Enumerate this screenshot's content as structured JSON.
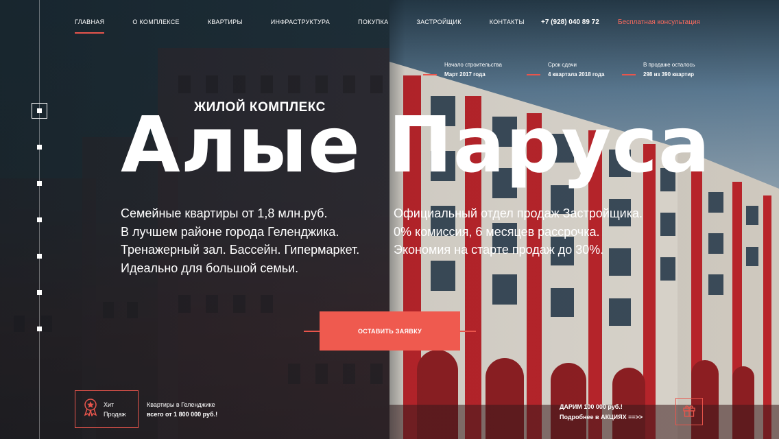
{
  "nav": {
    "items": [
      {
        "label": "ГЛАВНАЯ",
        "active": true
      },
      {
        "label": "О КОМПЛЕКСЕ",
        "active": false
      },
      {
        "label": "КВАРТИРЫ",
        "active": false
      },
      {
        "label": "ИНФРАСТРУКТУРА",
        "active": false
      },
      {
        "label": "ПОКУПКА",
        "active": false
      },
      {
        "label": "ЗАСТРОЙЩИК",
        "active": false
      },
      {
        "label": "КОНТАКТЫ",
        "active": false
      }
    ],
    "phone": "+7 (928) 040 89 72",
    "consult": "Бесплатная консультация"
  },
  "info": [
    {
      "label": "Начало строительства",
      "value": "Март 2017 года"
    },
    {
      "label": "Срок сдачи",
      "value": "4 квартала 2018 года"
    },
    {
      "label": "В продаже осталось",
      "value": "298 из 390 квартир"
    }
  ],
  "hero": {
    "subtitle": "ЖИЛОЙ КОМПЛЕКС",
    "title": "Алые Паруса",
    "features_left": [
      "Семейные квартиры от 1,8 млн.руб.",
      "В лучшем районе города Геленджика.",
      "Тренажерный зал. Бассейн. Гипермаркет.",
      "Идеально для большой семьи."
    ],
    "features_right": [
      "Официальный отдел продаж Застройщика.",
      "0% комиссия, 6 месяцев рассрочка.",
      "Экономия на старте продаж до 30%."
    ],
    "cta": "ОСТАВИТЬ ЗАЯВКУ"
  },
  "badge": {
    "line1": "Хит",
    "line2": "Продаж",
    "desc1": "Квартиры в Геленджике",
    "desc2": "всего от 1 800 000 руб.!"
  },
  "promo": {
    "line1": "ДАРИМ 100 000 руб.!",
    "line2": "Подробнее в АКЦИЯХ ==>>"
  },
  "colors": {
    "accent": "#ef5a4f",
    "consult_link": "#ff6b5e"
  },
  "icons": [
    "award-medal-icon",
    "gift-icon"
  ]
}
